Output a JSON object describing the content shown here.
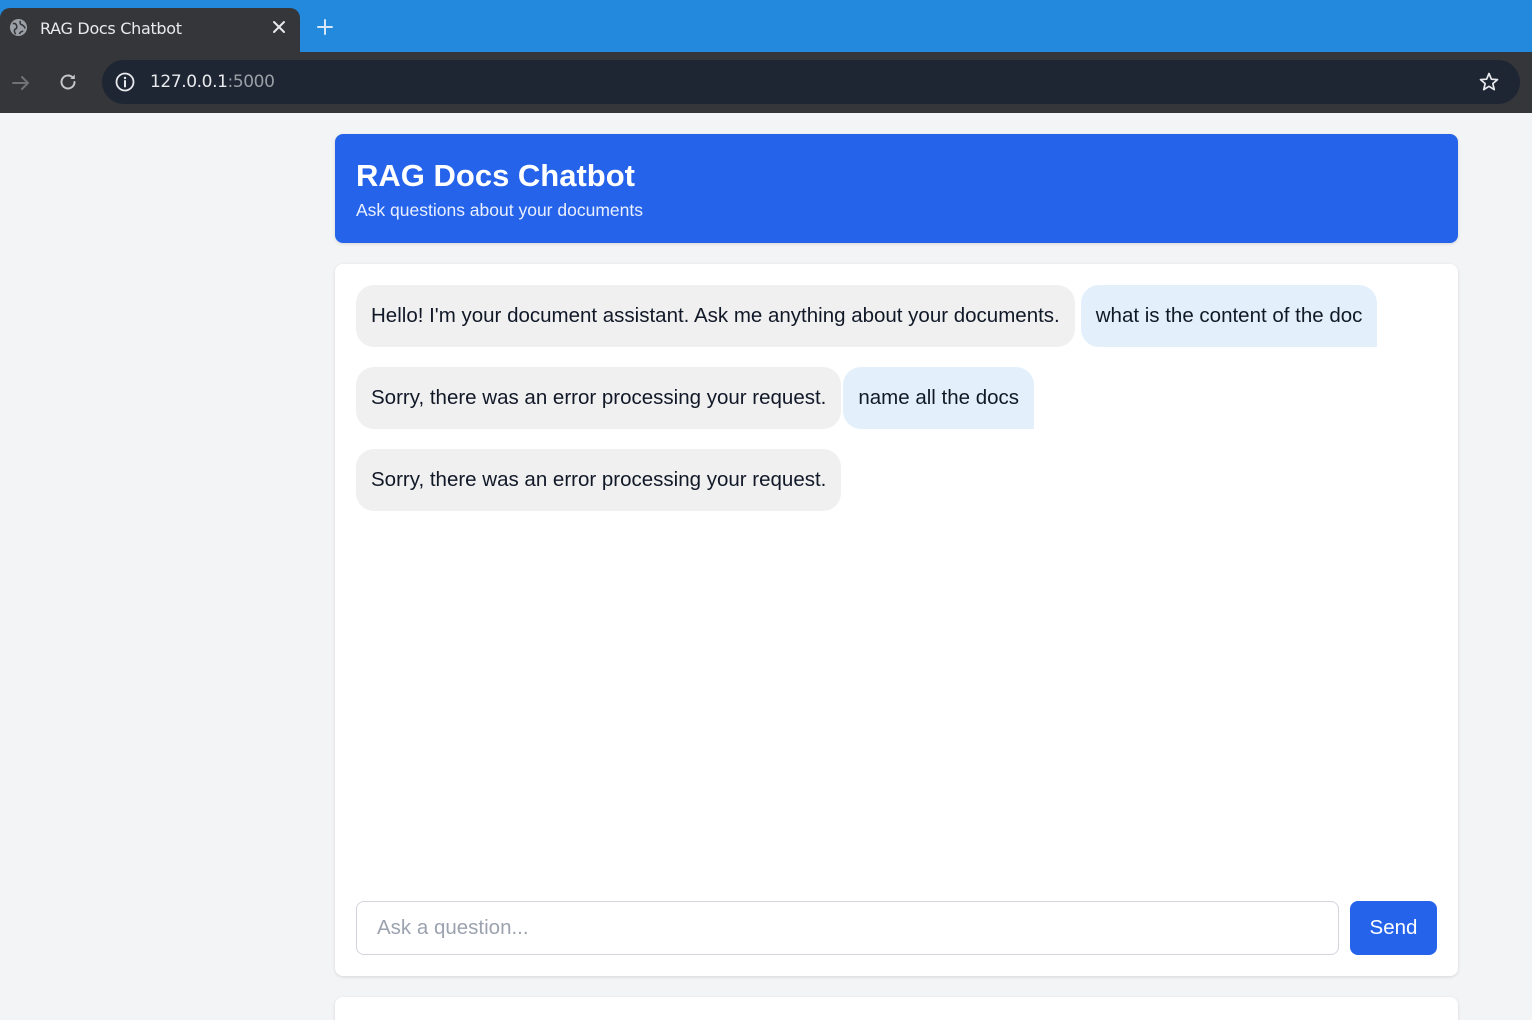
{
  "browser": {
    "tab_title": "RAG Docs Chatbot",
    "url_host": "127.0.0.1",
    "url_port": ":5000"
  },
  "header": {
    "title": "RAG Docs Chatbot",
    "subtitle": "Ask questions about your documents"
  },
  "messages": [
    {
      "role": "bot",
      "text": "Hello! I'm your document assistant. Ask me anything about your documents."
    },
    {
      "role": "user",
      "text": "what is the content of the doc"
    },
    {
      "role": "bot",
      "text": "Sorry, there was an error processing your request."
    },
    {
      "role": "user",
      "text": "name all the docs"
    },
    {
      "role": "bot",
      "text": "Sorry, there was an error processing your request."
    }
  ],
  "input": {
    "placeholder": "Ask a question...",
    "value": ""
  },
  "send_label": "Send",
  "colors": {
    "accent": "#2563eb",
    "bot_bubble": "#f0f0f0",
    "user_bubble": "#e3f0fc",
    "chrome_tabstrip": "#2389dd"
  }
}
